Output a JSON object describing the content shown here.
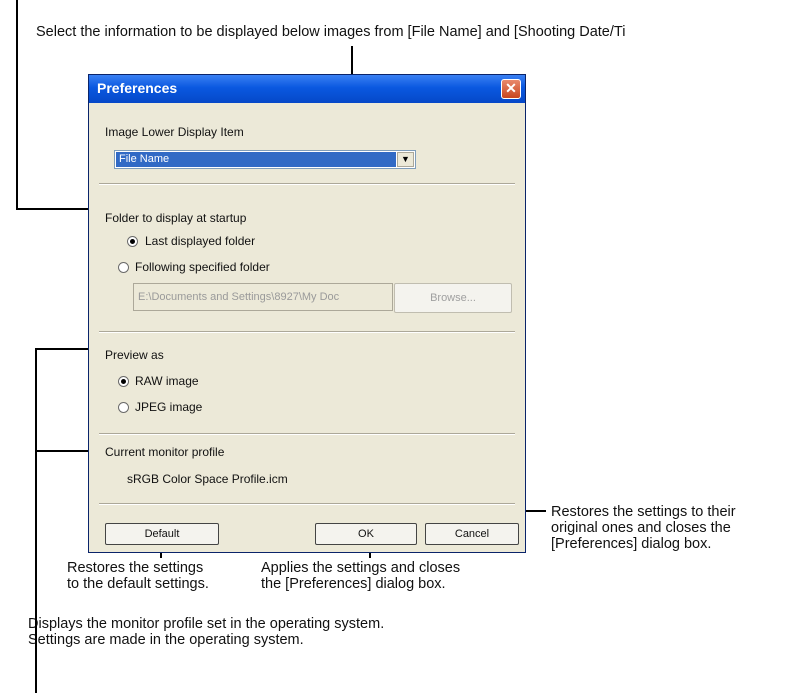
{
  "annotations": {
    "top": "Select the information to be displayed below images from [File Name] and [Shooting Date/Ti",
    "cancel_line1": "Restores the settings to their",
    "cancel_line2": "original ones and closes the",
    "cancel_line3": "[Preferences] dialog box.",
    "default_line1": "Restores the settings",
    "default_line2": "to the default settings.",
    "ok_line1": "Applies the settings and closes",
    "ok_line2": "the [Preferences] dialog box.",
    "monitor_line1": "Displays the monitor profile set in the operating system.",
    "monitor_line2": "Settings are made in the operating system."
  },
  "dialog": {
    "title": "Preferences",
    "close_glyph": "✕",
    "image_lower_label": "Image Lower Display Item",
    "image_lower_value": "File Name",
    "dropdown_arrow": "▼",
    "folder_label": "Folder to display at startup",
    "folder_opt1": "Last displayed folder",
    "folder_opt2": "Following specified folder",
    "folder_path": "E:\\Documents and Settings\\8927\\My Doc",
    "browse_label": "Browse...",
    "preview_label": "Preview as",
    "preview_opt1": "RAW image",
    "preview_opt2": "JPEG image",
    "monitor_label": "Current monitor profile",
    "monitor_value": "sRGB Color Space Profile.icm",
    "default_label": "Default",
    "ok_label": "OK",
    "cancel_label": "Cancel"
  }
}
